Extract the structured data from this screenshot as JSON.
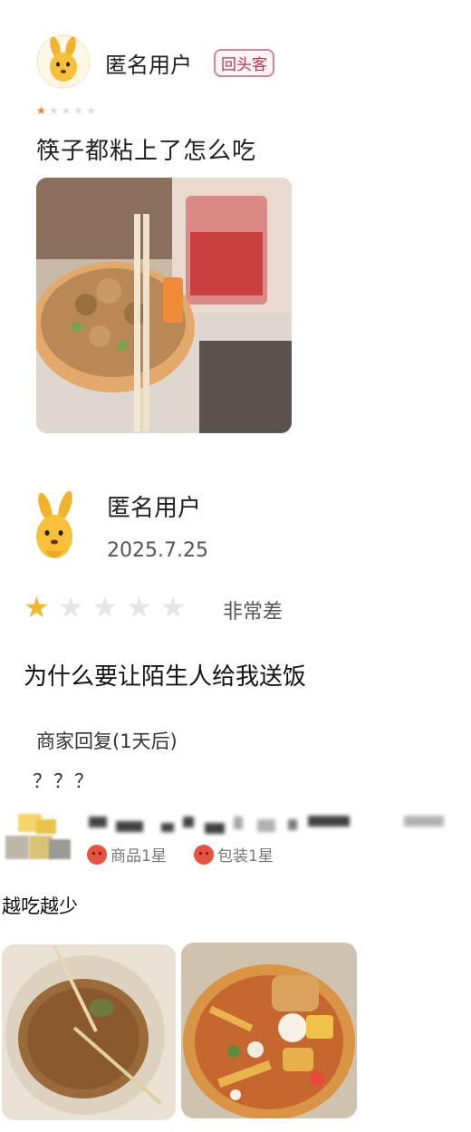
{
  "review1": {
    "user_name": "匿名用户",
    "badge": "回头客",
    "stars": 1,
    "comment": "筷子都粘上了怎么吃"
  },
  "review2": {
    "user_name": "匿名用户",
    "date": "2025.7.25",
    "stars": 1,
    "rating_text": "非常差",
    "comment": "为什么要让陌生人给我送饭",
    "merchant_reply_label": "商家回复(1天后)",
    "merchant_reply": "？？？"
  },
  "review3": {
    "tags": [
      "商品1星",
      "包装1星"
    ],
    "comment": "越吃越少"
  },
  "colors": {
    "star_orange": "#f07a2c",
    "star_gold": "#f2b72a",
    "badge_red": "#b2384a",
    "face_red": "#e8523f"
  }
}
